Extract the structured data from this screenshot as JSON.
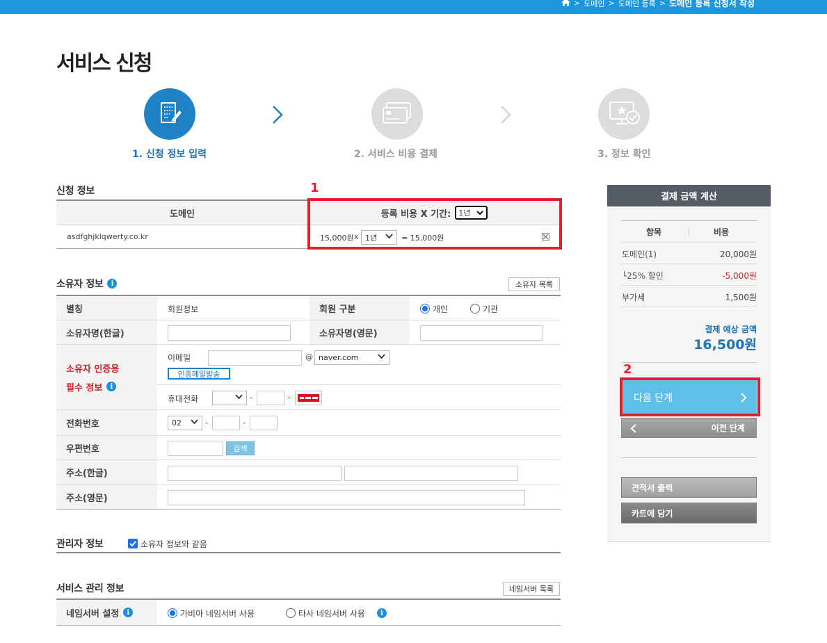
{
  "breadcrumb": {
    "items": [
      "도메인",
      "도메인 등록"
    ],
    "current": "도메인 등록 신청서 작성"
  },
  "page_title": "서비스 신청",
  "steps": [
    {
      "label": "1. 신청 정보 입력",
      "state": "active",
      "icon": "document-edit-icon"
    },
    {
      "label": "2. 서비스 비용 결제",
      "state": "inactive",
      "icon": "credit-card-icon"
    },
    {
      "label": "3. 정보 확인",
      "state": "inactive",
      "icon": "monitor-check-icon"
    }
  ],
  "application_info": {
    "title": "신청 정보",
    "col_domain": "도메인",
    "col_fee": "등록 비용 X 기간:",
    "period_header_value": "1년",
    "domain_value": "asdfghjklqwerty.co.kr",
    "fee_unit": "15,000원",
    "times": "x",
    "period_value": "1년",
    "fee_total": "= 15,000원",
    "remove_icon": "close-icon"
  },
  "annotations": {
    "box1": "1",
    "box2": "2"
  },
  "owner_info": {
    "title": "소유자 정보",
    "list_button": "소유자 목록",
    "nickname_label": "별칭",
    "nickname_value": "회원정보",
    "member_type_label": "회원 구분",
    "member_type_individual": "개인",
    "member_type_org": "기관",
    "name_kr_label": "소유자명(한글)",
    "name_en_label": "소유자명(영문)",
    "auth_label_line1": "소유자 인증용",
    "auth_label_line2": "필수 정보",
    "email_label": "이메일",
    "email_at": "@",
    "email_domain": "naver.com",
    "send_mail_button": "인증메일발송",
    "mobile_label": "휴대전화",
    "dash": "-",
    "phone_label": "전화번호",
    "phone_prefix": "02",
    "zip_label": "우편번호",
    "search_button": "검색",
    "addr_kr_label": "주소(한글)",
    "addr_en_label": "주소(영문)"
  },
  "admin_info": {
    "title": "관리자 정보",
    "same_as_owner": "소유자 정보와 같음"
  },
  "service_info": {
    "title": "서비스 관리 정보",
    "ns_list_button": "네임서버 목록",
    "ns_label": "네임서버 설정",
    "ns_gabia": "가비아 네임서버 사용",
    "ns_other": "타사 네임서버 사용"
  },
  "payment": {
    "title": "결제 금액 계산",
    "col_item": "항목",
    "col_cost": "비용",
    "rows": [
      {
        "label": "도메인(1)",
        "value": "20,000원"
      },
      {
        "label": "└25% 할인",
        "value": "-5,000원"
      },
      {
        "label": "부가세",
        "value": "1,500원"
      }
    ],
    "expected_label": "결제 예상 금액",
    "expected_value": "16,500원",
    "next_button": "다음 단계",
    "prev_button": "이전 단계",
    "quote_button": "견적서 출력",
    "cart_button": "카트에 담기"
  },
  "colors": {
    "accent": "#1d82c6",
    "topbar": "#1e96dc",
    "highlight": "#e0202a",
    "next_button": "#5cc0ea",
    "discount": "#e0202a"
  }
}
